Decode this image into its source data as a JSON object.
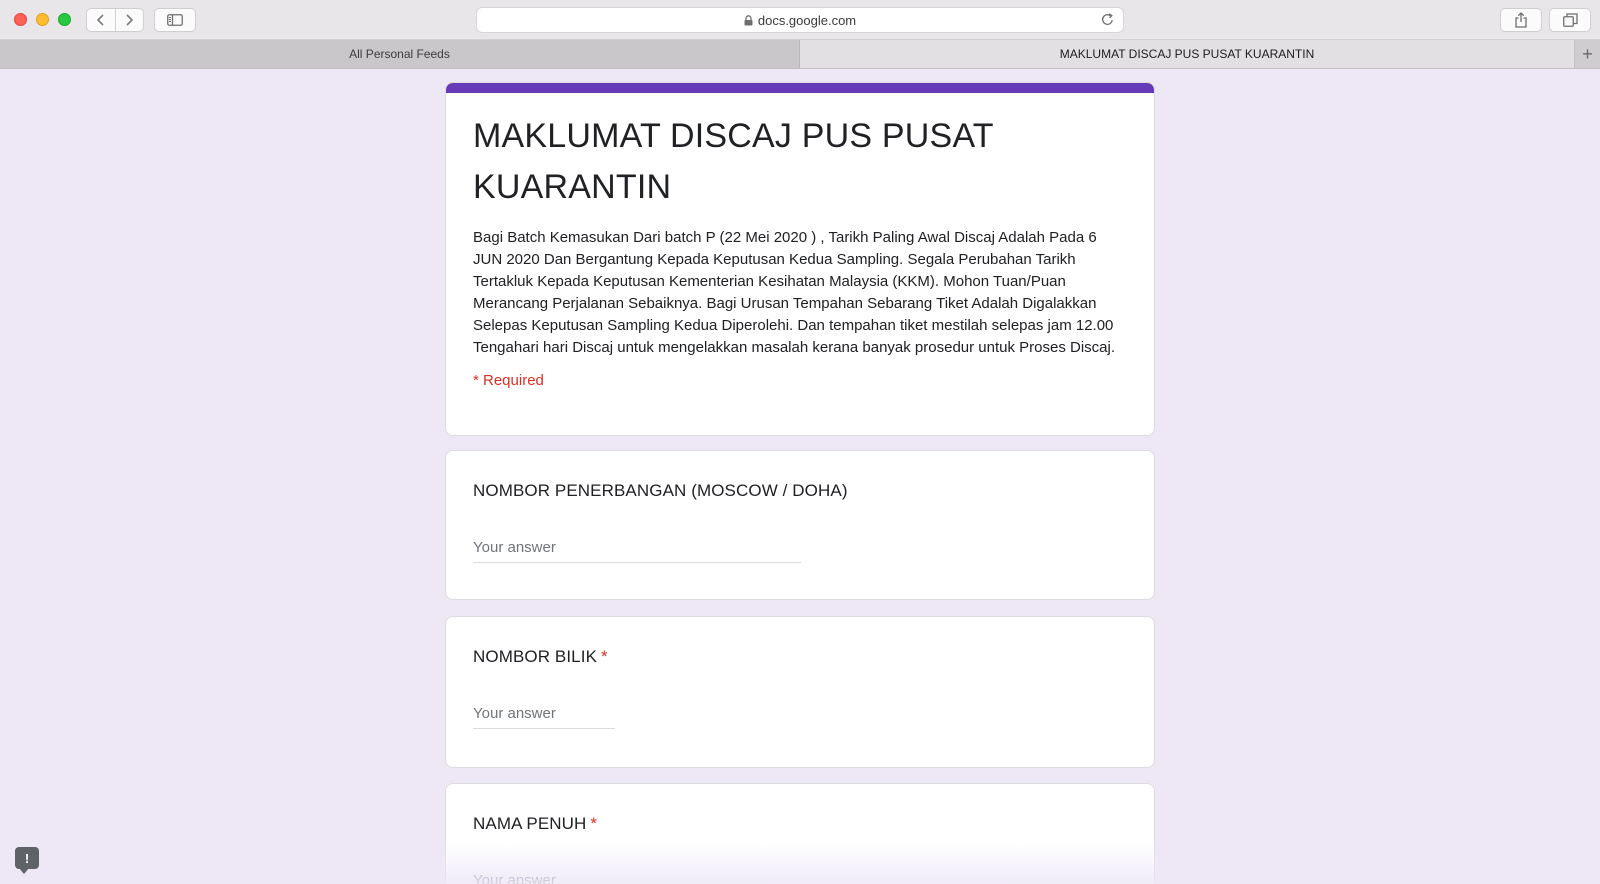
{
  "browser": {
    "url": "docs.google.com",
    "tabs": [
      {
        "label": "All Personal Feeds",
        "active": false
      },
      {
        "label": "MAKLUMAT DISCAJ PUS PUSAT KUARANTIN",
        "active": true
      }
    ],
    "new_tab_label": "+"
  },
  "form": {
    "title": "MAKLUMAT DISCAJ PUS PUSAT KUARANTIN",
    "description": "Bagi Batch Kemasukan Dari batch P (22 Mei 2020 ) , Tarikh Paling Awal Discaj Adalah Pada 6 JUN 2020 Dan Bergantung Kepada Keputusan Kedua Sampling. Segala Perubahan Tarikh Tertakluk Kepada Keputusan Kementerian Kesihatan Malaysia (KKM). Mohon Tuan/Puan Merancang Perjalanan Sebaiknya. Bagi Urusan Tempahan Sebarang Tiket Adalah Digalakkan Selepas Keputusan Sampling Kedua Diperolehi. Dan tempahan tiket mestilah selepas jam 12.00 Tengahari hari Discaj untuk mengelakkan masalah kerana banyak prosedur untuk Proses Discaj.",
    "required_note": "* Required",
    "accent_color": "#673ab7",
    "questions": [
      {
        "title": "NOMBOR PENERBANGAN (MOSCOW / DOHA)",
        "required_mark": "",
        "placeholder": "Your answer"
      },
      {
        "title": "NOMBOR BILIK",
        "required_mark": "*",
        "placeholder": "Your answer"
      },
      {
        "title": "NAMA PENUH",
        "required_mark": "*",
        "placeholder": "Your answer"
      }
    ]
  },
  "feedback": {
    "label": "!"
  }
}
